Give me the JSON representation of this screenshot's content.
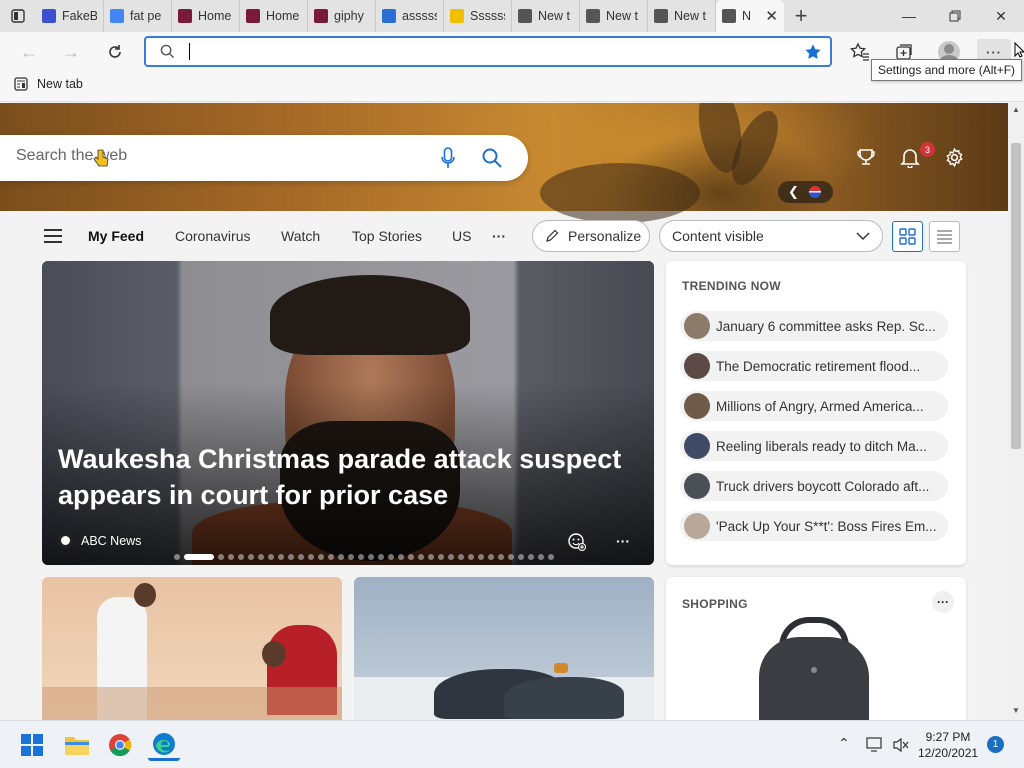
{
  "browser": {
    "tabs": [
      {
        "title": "FakeB",
        "favicon_color": "#3b4fd1"
      },
      {
        "title": "fat pe",
        "favicon_color": "#4285f4"
      },
      {
        "title": "Home",
        "favicon_color": "#7a1a3a"
      },
      {
        "title": "Home",
        "favicon_color": "#7a1a3a"
      },
      {
        "title": "giphy",
        "favicon_color": "#7a1a3a"
      },
      {
        "title": "asssss",
        "favicon_color": "#2a6fd6"
      },
      {
        "title": "Ssssss",
        "favicon_color": "#f0c000"
      },
      {
        "title": "New t",
        "favicon_color": "#555555"
      },
      {
        "title": "New t",
        "favicon_color": "#555555"
      },
      {
        "title": "New t",
        "favicon_color": "#555555"
      },
      {
        "title": "N",
        "favicon_color": "#555555",
        "active": true
      }
    ],
    "address_value": "",
    "tooltip": "Settings and more (Alt+F)",
    "favorites": [
      {
        "label": "New tab"
      }
    ]
  },
  "ntp": {
    "search_placeholder": "Search the web",
    "notification_count": "3",
    "nav": {
      "items": [
        "My Feed",
        "Coronavirus",
        "Watch",
        "Top Stories",
        "US"
      ],
      "more": "···",
      "personalize": "Personalize",
      "content_visibility": "Content visible"
    },
    "hero_story": {
      "headline": "Waukesha Christmas parade attack suspect appears in court for prior case",
      "source": "ABC News",
      "slide_count": 36,
      "active_slide": 1
    },
    "trending": {
      "title": "TRENDING NOW",
      "items": [
        {
          "text": "January 6 committee asks Rep. Sc...",
          "avatar_color": "#8c7a6b"
        },
        {
          "text": "The Democratic retirement flood...",
          "avatar_color": "#5b4a45"
        },
        {
          "text": "Millions of Angry, Armed America...",
          "avatar_color": "#6e5a48"
        },
        {
          "text": "Reeling liberals ready to ditch Ma...",
          "avatar_color": "#3e4a66"
        },
        {
          "text": "Truck drivers boycott Colorado aft...",
          "avatar_color": "#4a5056"
        },
        {
          "text": "'Pack Up Your S**t': Boss Fires Em...",
          "avatar_color": "#b8a89a"
        }
      ]
    },
    "shopping": {
      "title": "SHOPPING",
      "more": "···"
    }
  },
  "taskbar": {
    "time": "9:27 PM",
    "date": "12/20/2021",
    "notifications": "1"
  }
}
